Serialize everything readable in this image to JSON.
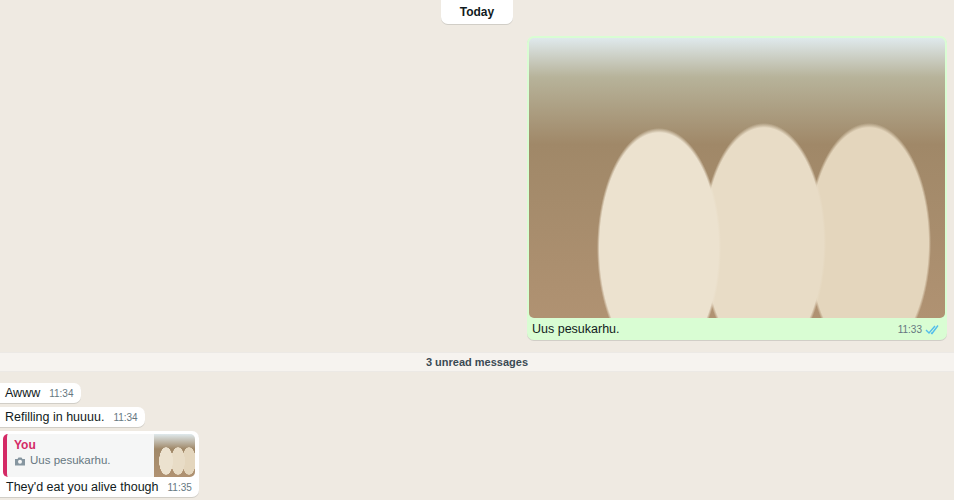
{
  "date_pill": "Today",
  "timeline": [
    {
      "kind": "image",
      "outgoing": true,
      "caption": "Uus pesukarhu.",
      "time": "11:33",
      "read": true
    },
    {
      "kind": "divider",
      "text": "3 unread messages"
    },
    {
      "kind": "text",
      "outgoing": false,
      "text": "Awww",
      "time": "11:34"
    },
    {
      "kind": "text",
      "outgoing": false,
      "text": "Refilling in huuuu.",
      "time": "11:34"
    },
    {
      "kind": "reply",
      "outgoing": false,
      "quote": {
        "author": "You",
        "text": "Uus pesukarhu."
      },
      "text": "They'd eat you alive though",
      "time": "11:35"
    }
  ]
}
